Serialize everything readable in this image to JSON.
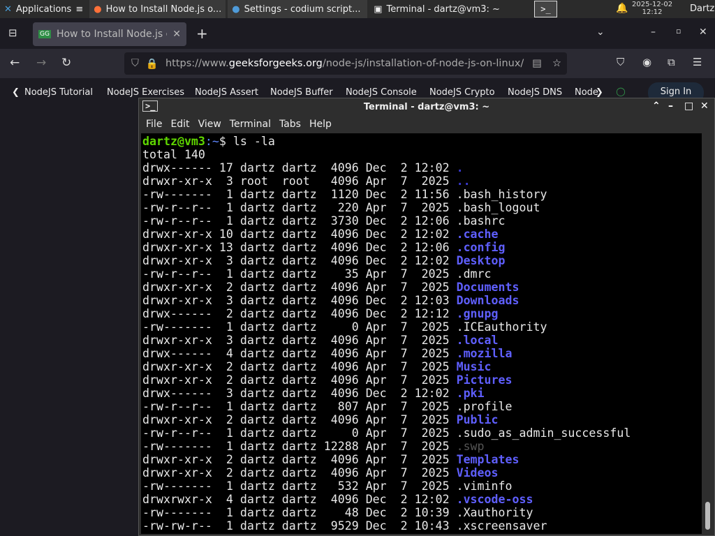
{
  "panel": {
    "apps_label": "Applications",
    "tasks": [
      "How to Install Node.js o...",
      "Settings - codium script...",
      "Terminal - dartz@vm3: ~"
    ],
    "date": "2025-12-02",
    "time": "12:12",
    "user": "Dartz"
  },
  "browser": {
    "tab_title": "How to Install Node.js or",
    "url_prefix": "https://www.",
    "url_domain": "geeksforgeeks.org",
    "url_path": "/node-js/installation-of-node-js-on-linux/",
    "bookmarks": [
      "NodeJS Tutorial",
      "NodeJS Exercises",
      "NodeJS Assert",
      "NodeJS Buffer",
      "NodeJS Console",
      "NodeJS Crypto",
      "NodeJS DNS",
      "Node"
    ],
    "sign_in": "Sign In"
  },
  "terminal": {
    "title": "Terminal - dartz@vm3: ~",
    "menu": [
      "File",
      "Edit",
      "View",
      "Terminal",
      "Tabs",
      "Help"
    ],
    "prompt_user": "dartz@vm3",
    "prompt_path": ":~",
    "prompt_sym": "$ ",
    "command": "ls -la",
    "total": "total 140",
    "colors": {
      "dir": "#5f5fff",
      "prompt": "#5fd700"
    },
    "entries": [
      [
        "drwx------",
        "17",
        "dartz",
        "dartz",
        "4096",
        "Dec",
        "2",
        "12:02",
        ".",
        "dot"
      ],
      [
        "drwxr-xr-x",
        "3",
        "root",
        "root",
        "4096",
        "Apr",
        "7",
        "2025",
        "..",
        "dot"
      ],
      [
        "-rw-------",
        "1",
        "dartz",
        "dartz",
        "1120",
        "Dec",
        "2",
        "11:56",
        ".bash_history",
        "file"
      ],
      [
        "-rw-r--r--",
        "1",
        "dartz",
        "dartz",
        "220",
        "Apr",
        "7",
        "2025",
        ".bash_logout",
        "file"
      ],
      [
        "-rw-r--r--",
        "1",
        "dartz",
        "dartz",
        "3730",
        "Dec",
        "2",
        "12:06",
        ".bashrc",
        "file"
      ],
      [
        "drwxr-xr-x",
        "10",
        "dartz",
        "dartz",
        "4096",
        "Dec",
        "2",
        "12:02",
        ".cache",
        "dir"
      ],
      [
        "drwxr-xr-x",
        "13",
        "dartz",
        "dartz",
        "4096",
        "Dec",
        "2",
        "12:06",
        ".config",
        "dir"
      ],
      [
        "drwxr-xr-x",
        "3",
        "dartz",
        "dartz",
        "4096",
        "Dec",
        "2",
        "12:02",
        "Desktop",
        "dir"
      ],
      [
        "-rw-r--r--",
        "1",
        "dartz",
        "dartz",
        "35",
        "Apr",
        "7",
        "2025",
        ".dmrc",
        "file"
      ],
      [
        "drwxr-xr-x",
        "2",
        "dartz",
        "dartz",
        "4096",
        "Apr",
        "7",
        "2025",
        "Documents",
        "dir"
      ],
      [
        "drwxr-xr-x",
        "3",
        "dartz",
        "dartz",
        "4096",
        "Dec",
        "2",
        "12:03",
        "Downloads",
        "dir"
      ],
      [
        "drwx------",
        "2",
        "dartz",
        "dartz",
        "4096",
        "Dec",
        "2",
        "12:12",
        ".gnupg",
        "dir"
      ],
      [
        "-rw-------",
        "1",
        "dartz",
        "dartz",
        "0",
        "Apr",
        "7",
        "2025",
        ".ICEauthority",
        "file"
      ],
      [
        "drwxr-xr-x",
        "3",
        "dartz",
        "dartz",
        "4096",
        "Apr",
        "7",
        "2025",
        ".local",
        "dir"
      ],
      [
        "drwx------",
        "4",
        "dartz",
        "dartz",
        "4096",
        "Apr",
        "7",
        "2025",
        ".mozilla",
        "dir"
      ],
      [
        "drwxr-xr-x",
        "2",
        "dartz",
        "dartz",
        "4096",
        "Apr",
        "7",
        "2025",
        "Music",
        "dir"
      ],
      [
        "drwxr-xr-x",
        "2",
        "dartz",
        "dartz",
        "4096",
        "Apr",
        "7",
        "2025",
        "Pictures",
        "dir"
      ],
      [
        "drwx------",
        "3",
        "dartz",
        "dartz",
        "4096",
        "Dec",
        "2",
        "12:02",
        ".pki",
        "dir"
      ],
      [
        "-rw-r--r--",
        "1",
        "dartz",
        "dartz",
        "807",
        "Apr",
        "7",
        "2025",
        ".profile",
        "file"
      ],
      [
        "drwxr-xr-x",
        "2",
        "dartz",
        "dartz",
        "4096",
        "Apr",
        "7",
        "2025",
        "Public",
        "dir"
      ],
      [
        "-rw-r--r--",
        "1",
        "dartz",
        "dartz",
        "0",
        "Apr",
        "7",
        "2025",
        ".sudo_as_admin_successful",
        "file"
      ],
      [
        "-rw-------",
        "1",
        "dartz",
        "dartz",
        "12288",
        "Apr",
        "7",
        "2025",
        ".swp",
        "swp"
      ],
      [
        "drwxr-xr-x",
        "2",
        "dartz",
        "dartz",
        "4096",
        "Apr",
        "7",
        "2025",
        "Templates",
        "dir"
      ],
      [
        "drwxr-xr-x",
        "2",
        "dartz",
        "dartz",
        "4096",
        "Apr",
        "7",
        "2025",
        "Videos",
        "dir"
      ],
      [
        "-rw-------",
        "1",
        "dartz",
        "dartz",
        "532",
        "Apr",
        "7",
        "2025",
        ".viminfo",
        "file"
      ],
      [
        "drwxrwxr-x",
        "4",
        "dartz",
        "dartz",
        "4096",
        "Dec",
        "2",
        "12:02",
        ".vscode-oss",
        "dir"
      ],
      [
        "-rw-------",
        "1",
        "dartz",
        "dartz",
        "48",
        "Dec",
        "2",
        "10:39",
        ".Xauthority",
        "file"
      ],
      [
        "-rw-rw-r--",
        "1",
        "dartz",
        "dartz",
        "9529",
        "Dec",
        "2",
        "10:43",
        ".xscreensaver",
        "file"
      ]
    ]
  }
}
